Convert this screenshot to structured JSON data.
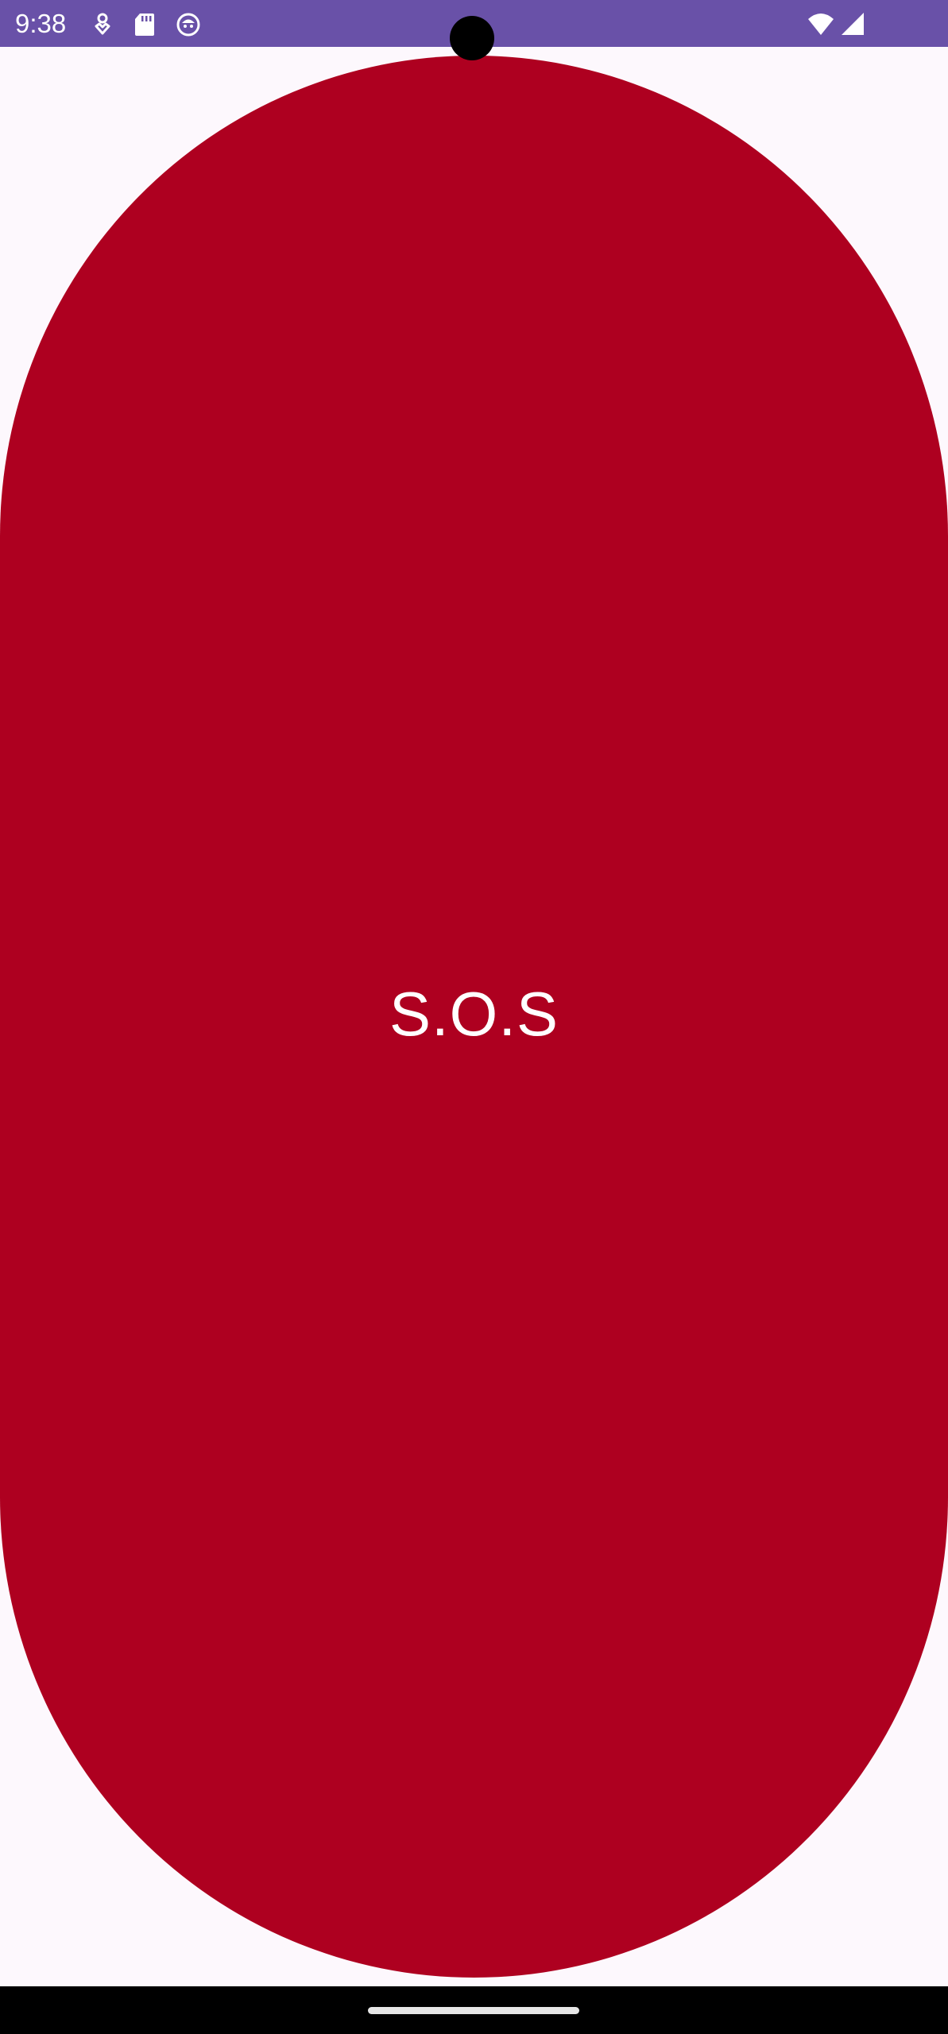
{
  "status_bar": {
    "time": "9:38",
    "left_icons": [
      "heart-location-icon",
      "sd-card-icon",
      "face-icon"
    ],
    "right_icons": [
      "wifi-icon",
      "cell-signal-icon"
    ],
    "background_color": "#6951a8"
  },
  "main": {
    "sos_button": {
      "label": "S.O.S",
      "color": "#ae0020",
      "text_color": "#ffffff"
    },
    "background_color": "#fdf8fd"
  },
  "nav_bar": {
    "type": "gesture",
    "background_color": "#000000"
  }
}
